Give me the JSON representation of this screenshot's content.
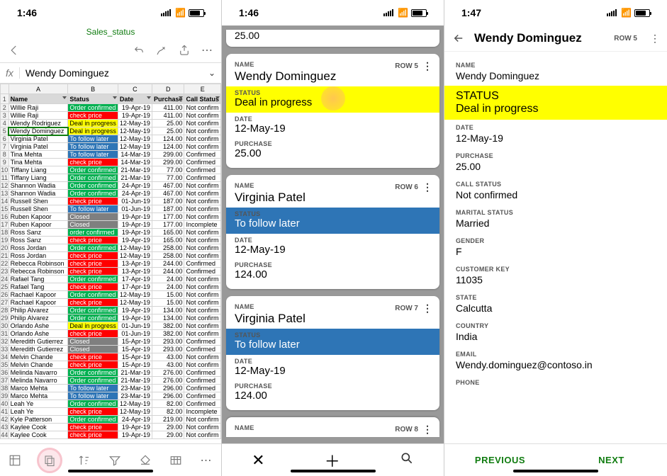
{
  "panel1": {
    "time": "1:46",
    "docTitle": "Sales_status",
    "fxValue": "Wendy Dominguez",
    "cols": [
      "A",
      "B",
      "C",
      "D",
      "E"
    ],
    "headers": [
      "Name",
      "Status",
      "Date",
      "Purchase",
      "Call Status"
    ],
    "rows": [
      {
        "n": "Willie Raji",
        "s": "Order confirmed",
        "sc": "green",
        "d": "19-Apr-19",
        "p": "411.00",
        "c": "Not confirm"
      },
      {
        "n": "Willie Raji",
        "s": "check price",
        "sc": "red",
        "d": "19-Apr-19",
        "p": "411.00",
        "c": "Not confirm"
      },
      {
        "n": "Wendy Rodriguez",
        "s": "Deal in progress",
        "sc": "yellow",
        "d": "12-May-19",
        "p": "25.00",
        "c": "Not confirm"
      },
      {
        "n": "Wendy Dominguez",
        "s": "Deal in progress",
        "sc": "yellow",
        "d": "12-May-19",
        "p": "25.00",
        "c": "Not confirm",
        "sel": true
      },
      {
        "n": "Virginia Patel",
        "s": "To follow later",
        "sc": "blue",
        "d": "12-May-19",
        "p": "124.00",
        "c": "Not confirm"
      },
      {
        "n": "Virginia Patel",
        "s": "To follow later",
        "sc": "blue",
        "d": "12-May-19",
        "p": "124.00",
        "c": "Not confirm"
      },
      {
        "n": "Tina Mehta",
        "s": "To follow later",
        "sc": "blue",
        "d": "14-Mar-19",
        "p": "299.00",
        "c": "Confirmed"
      },
      {
        "n": "Tina Mehta",
        "s": "check price",
        "sc": "red",
        "d": "14-Mar-19",
        "p": "299.00",
        "c": "Confirmed"
      },
      {
        "n": "Tiffany Liang",
        "s": "Order confirmed",
        "sc": "green",
        "d": "21-Mar-19",
        "p": "77.00",
        "c": "Confirmed"
      },
      {
        "n": "Tiffany Liang",
        "s": "Order confirmed",
        "sc": "green",
        "d": "21-Mar-19",
        "p": "77.00",
        "c": "Confirmed"
      },
      {
        "n": "Shannon Wadia",
        "s": "Order confirmed",
        "sc": "green",
        "d": "24-Apr-19",
        "p": "467.00",
        "c": "Not confirm"
      },
      {
        "n": "Shannon Wadia",
        "s": "Order confirmed",
        "sc": "green",
        "d": "24-Apr-19",
        "p": "467.00",
        "c": "Not confirm"
      },
      {
        "n": "Russell Shen",
        "s": "check price",
        "sc": "red",
        "d": "01-Jun-19",
        "p": "187.00",
        "c": "Not confirm"
      },
      {
        "n": "Russell Shen",
        "s": "To follow later",
        "sc": "blue",
        "d": "01-Jun-19",
        "p": "187.00",
        "c": "Not confirm"
      },
      {
        "n": "Ruben Kapoor",
        "s": "Closed",
        "sc": "grey",
        "d": "19-Apr-19",
        "p": "177.00",
        "c": "Not confirm"
      },
      {
        "n": "Ruben Kapoor",
        "s": "Closed",
        "sc": "grey",
        "d": "19-Apr-19",
        "p": "177.00",
        "c": "Incomplete"
      },
      {
        "n": "Ross Sanz",
        "s": "order confirmed",
        "sc": "green",
        "d": "19-Apr-19",
        "p": "165.00",
        "c": "Not confirm"
      },
      {
        "n": "Ross Sanz",
        "s": "check price",
        "sc": "red",
        "d": "19-Apr-19",
        "p": "165.00",
        "c": "Not confirm"
      },
      {
        "n": "Ross Jordan",
        "s": "Order confirmed",
        "sc": "green",
        "d": "12-May-19",
        "p": "258.00",
        "c": "Not confirm"
      },
      {
        "n": "Ross Jordan",
        "s": "check price",
        "sc": "red",
        "d": "12-May-19",
        "p": "258.00",
        "c": "Not confirm"
      },
      {
        "n": "Rebecca Robinson",
        "s": "check price",
        "sc": "red",
        "d": "13-Apr-19",
        "p": "244.00",
        "c": "Confirmed"
      },
      {
        "n": "Rebecca Robinson",
        "s": "check price",
        "sc": "red",
        "d": "13-Apr-19",
        "p": "244.00",
        "c": "Confirmed"
      },
      {
        "n": "Rafael Tang",
        "s": "Order confirmed",
        "sc": "green",
        "d": "17-Apr-19",
        "p": "24.00",
        "c": "Not confirm"
      },
      {
        "n": "Rafael Tang",
        "s": "check price",
        "sc": "red",
        "d": "17-Apr-19",
        "p": "24.00",
        "c": "Not confirm"
      },
      {
        "n": "Rachael Kapoor",
        "s": "Order confirmed",
        "sc": "green",
        "d": "12-May-19",
        "p": "15.00",
        "c": "Not confirm"
      },
      {
        "n": "Rachael Kapoor",
        "s": "check price",
        "sc": "red",
        "d": "12-May-19",
        "p": "15.00",
        "c": "Not confirm"
      },
      {
        "n": "Philip Alvarez",
        "s": "Order confirmed",
        "sc": "green",
        "d": "19-Apr-19",
        "p": "134.00",
        "c": "Not confirm"
      },
      {
        "n": "Philip Alvarez",
        "s": "Order confirmed",
        "sc": "green",
        "d": "19-Apr-19",
        "p": "134.00",
        "c": "Not confirm"
      },
      {
        "n": "Orlando Ashe",
        "s": "Deal in progress",
        "sc": "yellow",
        "d": "01-Jun-19",
        "p": "382.00",
        "c": "Not confirm"
      },
      {
        "n": "Orlando Ashe",
        "s": "check price",
        "sc": "red",
        "d": "01-Jun-19",
        "p": "382.00",
        "c": "Not confirm"
      },
      {
        "n": "Meredith Gutierrez",
        "s": "Closed",
        "sc": "grey",
        "d": "15-Apr-19",
        "p": "293.00",
        "c": "Confirmed"
      },
      {
        "n": "Meredith Gutierrez",
        "s": "Closed",
        "sc": "grey",
        "d": "15-Apr-19",
        "p": "293.00",
        "c": "Confirmed"
      },
      {
        "n": "Melvin Chande",
        "s": "check price",
        "sc": "red",
        "d": "15-Apr-19",
        "p": "43.00",
        "c": "Not confirm"
      },
      {
        "n": "Melvin Chande",
        "s": "check price",
        "sc": "red",
        "d": "15-Apr-19",
        "p": "43.00",
        "c": "Not confirm"
      },
      {
        "n": "Melinda Navarro",
        "s": "Order confirmed",
        "sc": "green",
        "d": "21-Mar-19",
        "p": "276.00",
        "c": "Confirmed"
      },
      {
        "n": "Melinda Navarro",
        "s": "Order confirmed",
        "sc": "green",
        "d": "21-Mar-19",
        "p": "276.00",
        "c": "Confirmed"
      },
      {
        "n": "Marco Mehta",
        "s": "To follow later",
        "sc": "blue",
        "d": "23-Mar-19",
        "p": "296.00",
        "c": "Confirmed"
      },
      {
        "n": "Marco Mehta",
        "s": "To follow later",
        "sc": "blue",
        "d": "23-Mar-19",
        "p": "296.00",
        "c": "Confirmed"
      },
      {
        "n": "Leah Ye",
        "s": "Order confirmed",
        "sc": "green",
        "d": "12-May-19",
        "p": "82.00",
        "c": "Confirmed"
      },
      {
        "n": "Leah Ye",
        "s": "check price",
        "sc": "red",
        "d": "12-May-19",
        "p": "82.00",
        "c": "Incomplete"
      },
      {
        "n": "Kyle Patterson",
        "s": "Order confirmed",
        "sc": "green",
        "d": "24-Apr-19",
        "p": "219.00",
        "c": "Not confirm"
      },
      {
        "n": "Kaylee Cook",
        "s": "check price",
        "sc": "red",
        "d": "19-Apr-19",
        "p": "29.00",
        "c": "Not confirm"
      },
      {
        "n": "Kaylee Cook",
        "s": "check price",
        "sc": "red",
        "d": "19-Apr-19",
        "p": "29.00",
        "c": "Not confirm"
      }
    ]
  },
  "panel2": {
    "time": "1:46",
    "partialTopValue": "25.00",
    "cards": [
      {
        "rowTag": "ROW 5",
        "name": "Wendy Dominguez",
        "nameLabel": "NAME",
        "statusLabel": "STATUS",
        "status": "Deal in progress",
        "statusClass": "yellow",
        "touch": true,
        "dateLabel": "DATE",
        "date": "12-May-19",
        "purchLabel": "PURCHASE",
        "purchase": "25.00"
      },
      {
        "rowTag": "ROW 6",
        "name": "Virginia Patel",
        "nameLabel": "NAME",
        "statusLabel": "STATUS",
        "status": "To follow later",
        "statusClass": "blue",
        "dateLabel": "DATE",
        "date": "12-May-19",
        "purchLabel": "PURCHASE",
        "purchase": "124.00"
      },
      {
        "rowTag": "ROW 7",
        "name": "Virginia Patel",
        "nameLabel": "NAME",
        "statusLabel": "STATUS",
        "status": "To follow later",
        "statusClass": "blue",
        "dateLabel": "DATE",
        "date": "12-May-19",
        "purchLabel": "PURCHASE",
        "purchase": "124.00"
      }
    ],
    "partialBot": {
      "rowTag": "ROW 8",
      "nameLabel": "NAME"
    }
  },
  "panel3": {
    "time": "1:47",
    "title": "Wendy Dominguez",
    "rowTag": "ROW 5",
    "fields": [
      {
        "label": "NAME",
        "value": "Wendy Dominguez"
      },
      {
        "label": "STATUS",
        "value": "Deal in progress",
        "statusClass": "yellow"
      },
      {
        "label": "DATE",
        "value": "12-May-19"
      },
      {
        "label": "PURCHASE",
        "value": "25.00"
      },
      {
        "label": "CALL STATUS",
        "value": "Not confirmed"
      },
      {
        "label": "MARITAL STATUS",
        "value": "Married"
      },
      {
        "label": "GENDER",
        "value": "F"
      },
      {
        "label": "CUSTOMER KEY",
        "value": "11035"
      },
      {
        "label": "STATE",
        "value": "Calcutta"
      },
      {
        "label": "COUNTRY",
        "value": "India"
      },
      {
        "label": "EMAIL",
        "value": "Wendy.dominguez@contoso.in"
      },
      {
        "label": "PHONE",
        "value": ""
      }
    ],
    "prev": "PREVIOUS",
    "next": "NEXT"
  }
}
